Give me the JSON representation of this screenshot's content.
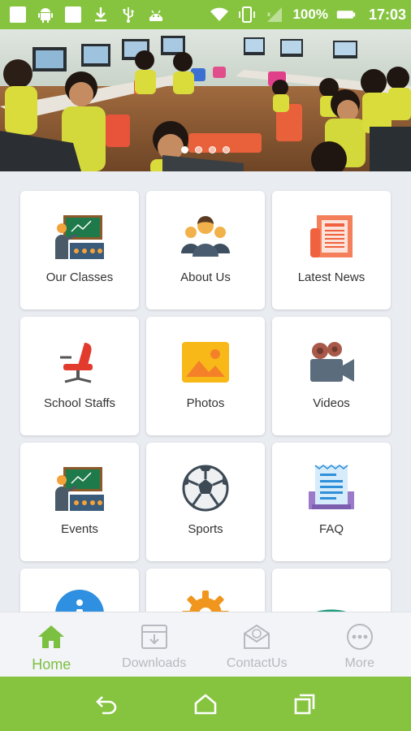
{
  "status_bar": {
    "battery_text": "100%",
    "time": "17:03",
    "icons": [
      "square-icon",
      "android-icon",
      "square-icon",
      "download-icon",
      "usb-icon",
      "android-head-icon",
      "wifi-icon",
      "vibrate-icon",
      "signal-icon",
      "battery-icon"
    ]
  },
  "hero": {
    "image": "classroom-photo",
    "slide_count": 4,
    "active_slide": 1
  },
  "grid": {
    "items": [
      {
        "label": "Our Classes",
        "icon": "classroom-icon"
      },
      {
        "label": "About Us",
        "icon": "group-icon"
      },
      {
        "label": "Latest News",
        "icon": "newspaper-icon"
      },
      {
        "label": "School Staffs",
        "icon": "chair-icon"
      },
      {
        "label": "Photos",
        "icon": "photo-icon"
      },
      {
        "label": "Videos",
        "icon": "video-camera-icon"
      },
      {
        "label": "Events",
        "icon": "classroom-icon"
      },
      {
        "label": "Sports",
        "icon": "soccer-ball-icon"
      },
      {
        "label": "FAQ",
        "icon": "document-icon"
      },
      {
        "label": "",
        "icon": "info-icon"
      },
      {
        "label": "",
        "icon": "gear-icon"
      },
      {
        "label": "",
        "icon": "phone-icon"
      }
    ]
  },
  "bottom_nav": {
    "items": [
      {
        "label": "Home",
        "icon": "home-icon",
        "active": true
      },
      {
        "label": "Downloads",
        "icon": "download-box-icon",
        "active": false
      },
      {
        "label": "ContactUs",
        "icon": "contact-icon",
        "active": false
      },
      {
        "label": "More",
        "icon": "more-icon",
        "active": false
      }
    ]
  },
  "system_nav": {
    "buttons": [
      "back-icon",
      "home-outline-icon",
      "recents-icon"
    ]
  },
  "colors": {
    "brand_green": "#86c440",
    "active_green": "#7cc041",
    "inactive_gray": "#b6b9bf",
    "background": "#e9ecf1"
  }
}
